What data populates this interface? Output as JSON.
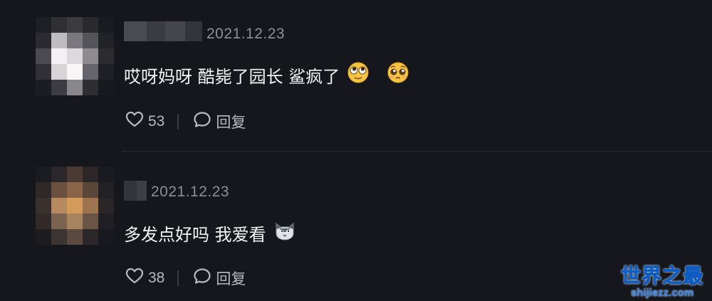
{
  "comments": [
    {
      "date": "2021.12.23",
      "text": "哎呀妈呀 酷毙了园长 鲨疯了",
      "emojis": [
        "eyes-rolling-emoji",
        "pleading-face-emoji"
      ],
      "likes": "53",
      "reply_label": "回复"
    },
    {
      "date": "2021.12.23",
      "text": "多发点好吗 我爱看",
      "emojis": [
        "cat-face-emoji"
      ],
      "likes": "38",
      "reply_label": "回复"
    }
  ],
  "watermark": {
    "title": "世界之最",
    "url": "shijiezz.com"
  },
  "colors": {
    "background": "#16171c",
    "text": "#f4f4f6",
    "muted": "#8d8e96",
    "watermark": "#2d7fe8"
  }
}
